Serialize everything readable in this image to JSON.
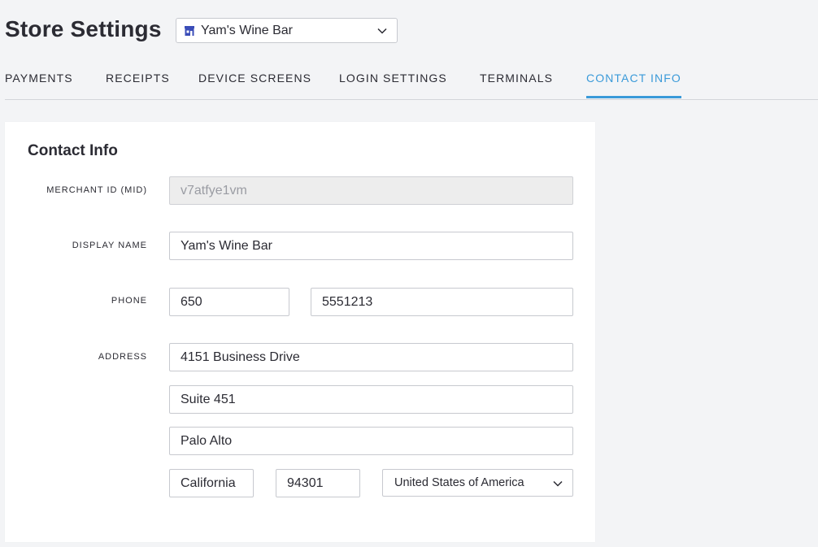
{
  "header": {
    "title": "Store Settings",
    "store_selector": {
      "value": "Yam's Wine Bar",
      "icon": "storefront-icon",
      "dropdown_icon": "chevron-down-icon"
    }
  },
  "tabs": [
    {
      "label": "PAYMENTS",
      "active": false
    },
    {
      "label": "RECEIPTS",
      "active": false
    },
    {
      "label": "DEVICE SCREENS",
      "active": false
    },
    {
      "label": "LOGIN SETTINGS",
      "active": false
    },
    {
      "label": "TERMINALS",
      "active": false
    },
    {
      "label": "CONTACT INFO",
      "active": true
    }
  ],
  "contact_info": {
    "title": "Contact Info",
    "merchant_id": {
      "label": "MERCHANT ID (MID)",
      "value": "v7atfye1vm",
      "disabled": true
    },
    "display_name": {
      "label": "DISPLAY NAME",
      "value": "Yam's Wine Bar"
    },
    "phone": {
      "label": "PHONE",
      "area_code": "650",
      "number": "5551213"
    },
    "address": {
      "label": "ADDRESS",
      "line1": "4151 Business Drive",
      "line2": "Suite 451",
      "city": "Palo Alto",
      "state": "California",
      "zip": "94301",
      "country": "United States of America"
    }
  },
  "colors": {
    "accent": "#3a9ad9",
    "background": "#f3f4f6",
    "text": "#2b2b33",
    "store_icon": "#3b4db8"
  }
}
